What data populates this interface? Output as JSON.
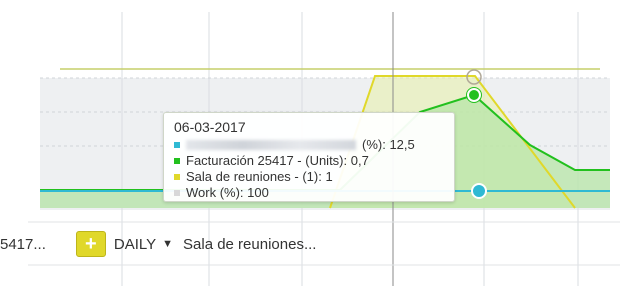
{
  "tooltip": {
    "date": "06-03-2017",
    "rows": [
      {
        "color": "#2fb9d3",
        "label": "(%): 12,5",
        "blurred": true
      },
      {
        "color": "#22c01e",
        "label": "Facturación 25417 - (Units): 0,7"
      },
      {
        "color": "#e0d82a",
        "label": "Sala de reuniones - (1): 1"
      },
      {
        "color": "#d8d8d8",
        "label": "Work (%): 100"
      }
    ]
  },
  "toolbar": {
    "left_label": "5417...",
    "add_button": "+",
    "period_label": "DAILY",
    "period_caret": "▼",
    "right_label": "Sala de reuniones..."
  },
  "colors": {
    "cyan": "#2fb9d3",
    "green": "#22c01e",
    "yellow": "#e0d82a",
    "gray": "#d8d8d8"
  },
  "icons": {
    "caret": "caret-down-icon",
    "add": "plus-icon"
  }
}
